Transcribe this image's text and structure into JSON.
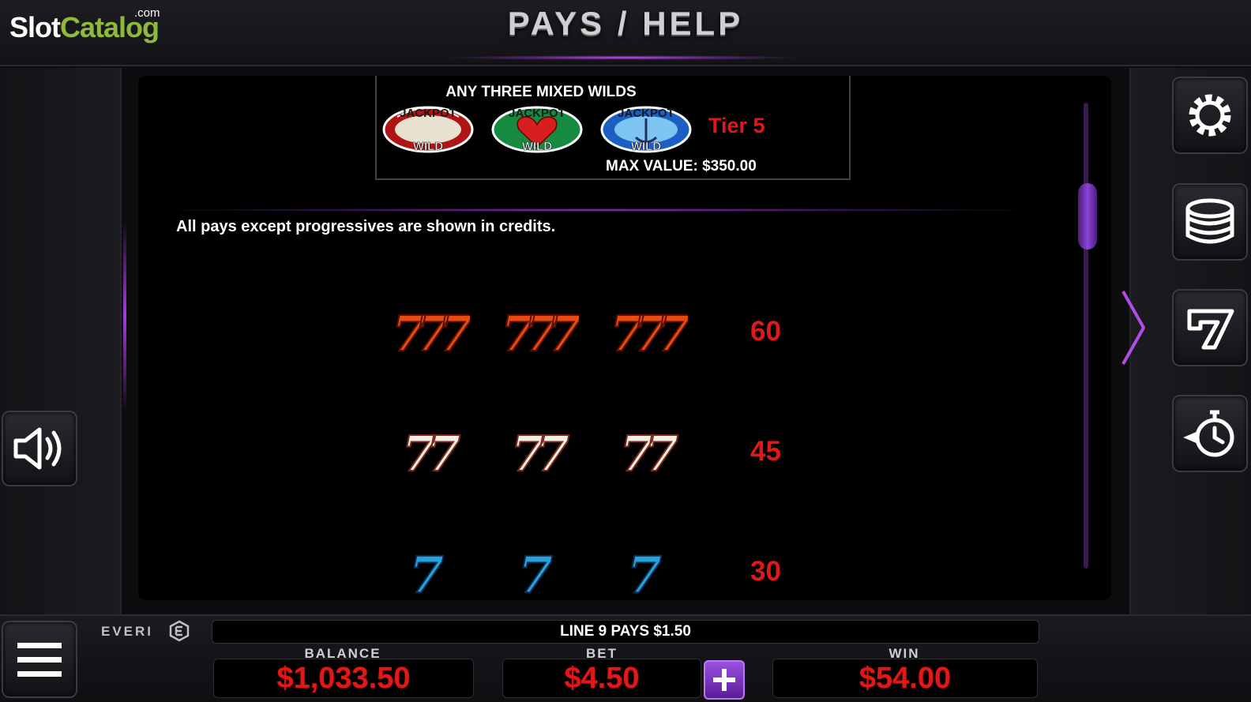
{
  "header": {
    "logo_main": "Slot",
    "logo_accent": "Catalog",
    "logo_suffix": ".com",
    "title": "PAYS / HELP"
  },
  "mixed_wilds": {
    "title": "ANY THREE MIXED WILDS",
    "symbols": [
      {
        "name": "jackpot-wild-red",
        "top_text": "JACKPOT",
        "bottom_text": "WILD",
        "color": "#d81e1e"
      },
      {
        "name": "jackpot-wild-green",
        "top_text": "JACKPOT",
        "bottom_text": "WILD",
        "color": "#1e9a4a"
      },
      {
        "name": "jackpot-wild-blue",
        "top_text": "JACKPOT",
        "bottom_text": "WILD",
        "color": "#1e6ad8"
      }
    ],
    "tier": "Tier 5",
    "max_value": "MAX VALUE: $350.00"
  },
  "note": "All pays except progressives are shown in credits.",
  "paytable": [
    {
      "symbol": "red-triple-seven",
      "count": 3,
      "color": "#e84a14",
      "value": "60"
    },
    {
      "symbol": "white-double-seven",
      "count": 3,
      "color": "#f2eee6",
      "value": "45"
    },
    {
      "symbol": "blue-seven",
      "count": 3,
      "color": "#2aa0d8",
      "value": "30"
    }
  ],
  "scroll": {
    "position": 0.18
  },
  "side_buttons": {
    "left": [
      "speaker-icon"
    ],
    "right": [
      "gear-icon",
      "coin-stack-icon",
      "seven-icon",
      "history-clock-icon"
    ],
    "menu": "hamburger-menu-icon"
  },
  "footer": {
    "brand": "EVERI",
    "message": "LINE 9 PAYS $1.50",
    "balance_label": "BALANCE",
    "balance_value": "$1,033.50",
    "bet_label": "BET",
    "bet_value": "$4.50",
    "win_label": "WIN",
    "win_value": "$54.00"
  },
  "colors": {
    "accent_purple": "#9b3ad8",
    "pay_red": "#e01818",
    "logo_green": "#8fb93a"
  }
}
